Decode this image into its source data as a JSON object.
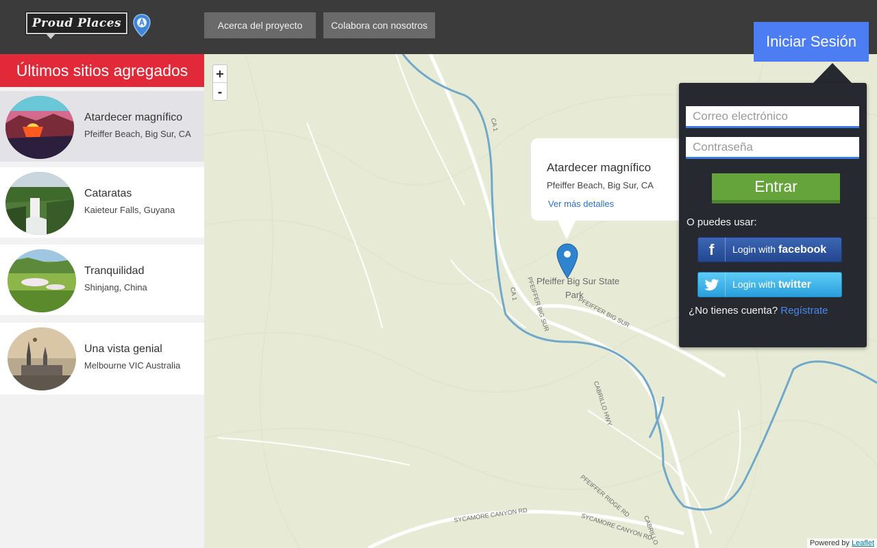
{
  "header": {
    "logo_text": "Proud Places",
    "nav": [
      {
        "label": "Acerca del proyecto"
      },
      {
        "label": "Colabora con nosotros"
      }
    ],
    "signin_label": "Iniciar Sesión"
  },
  "sidebar": {
    "title": "Últimos sitios agregados",
    "places": [
      {
        "name": "Atardecer magnífico",
        "location": "Pfeiffer Beach, Big Sur, CA",
        "icon": "sunset-photo"
      },
      {
        "name": "Cataratas",
        "location": "Kaieteur Falls, Guyana",
        "icon": "waterfall-photo"
      },
      {
        "name": "Tranquilidad",
        "location": "Shinjang, China",
        "icon": "meadow-photo"
      },
      {
        "name": "Una vista genial",
        "location": "Melbourne VIC Australia",
        "icon": "city-photo"
      }
    ]
  },
  "map": {
    "zoom_in": "+",
    "zoom_out": "-",
    "popup": {
      "title": "Atardecer magnífico",
      "location": "Pfeiffer Beach, Big Sur, CA",
      "link": "Ver más detalles"
    },
    "labels": {
      "park_line1": "Pfeiffer Big Sur State",
      "park_line2": "Park",
      "road_ca1_a": "CA 1",
      "road_ca1_b": "CA 1",
      "road_pbs1": "PFEIFFER BIG SUR",
      "road_pbs2": "PFEIFFER BIG SUR",
      "road_cabrillo": "CABRILLO HWY",
      "road_pridge": "PFEIFFER RIDGE RD",
      "road_syc1": "SYCAMORE CANYON RD",
      "road_syc2": "SYCAMORE CANYON RD",
      "road_cabr2": "CABRILLO"
    },
    "attribution_prefix": "Powered by",
    "attribution_link": "Leaflet"
  },
  "login": {
    "email_placeholder": "Correo electrónico",
    "password_placeholder": "Contraseña",
    "submit_label": "Entrar",
    "alt_text": "O puedes usar:",
    "facebook_prefix": "Login with",
    "facebook_brand": "facebook",
    "twitter_prefix": "Login with",
    "twitter_brand": "twitter",
    "no_account": "¿No tienes cuenta?",
    "register_label": "Regístrate"
  },
  "colors": {
    "header_bg": "#3b3b3b",
    "accent_red": "#e1293a",
    "signin_blue": "#4c7df2",
    "login_panel": "#262a30",
    "enter_green": "#64a43a",
    "map_bg": "#e7ebd6",
    "river_blue": "#6fa8c9"
  }
}
